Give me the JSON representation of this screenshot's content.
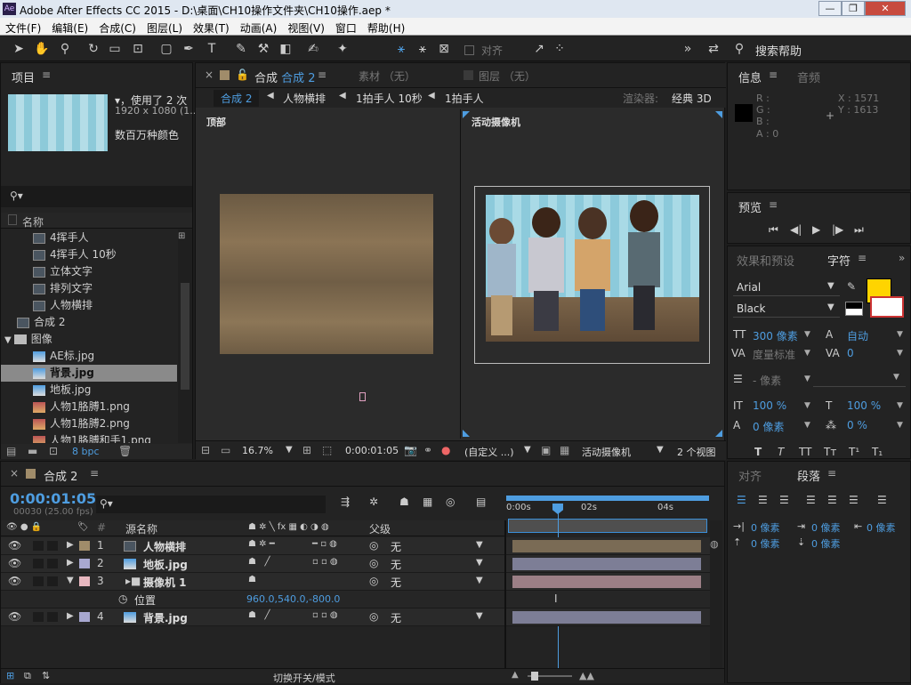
{
  "titlebar": {
    "title": "Adobe After Effects CC 2015 - D:\\桌面\\CH10操作文件夹\\CH10操作.aep *",
    "min": "—",
    "max": "❐",
    "close": "✕"
  },
  "menu": [
    "文件(F)",
    "编辑(E)",
    "合成(C)",
    "图层(L)",
    "效果(T)",
    "动画(A)",
    "视图(V)",
    "窗口",
    "帮助(H)"
  ],
  "toolbar": {
    "align": "对齐",
    "search": "搜索帮助"
  },
  "project": {
    "tab": "项目",
    "info_line1": "▾，使用了 2 次",
    "info_line2": "1920 x 1080 (1...",
    "info_line3": "数百万种颜色",
    "search_placeholder": "",
    "col_name": "名称",
    "items": [
      {
        "label": "4挥手人",
        "type": "comp"
      },
      {
        "label": "4挥手人 10秒",
        "type": "comp"
      },
      {
        "label": "立体文字",
        "type": "comp"
      },
      {
        "label": "排列文字",
        "type": "comp"
      },
      {
        "label": "人物横排",
        "type": "comp"
      },
      {
        "label": "合成 2",
        "type": "comp"
      },
      {
        "label": "图像",
        "type": "folder"
      },
      {
        "label": "AE标.jpg",
        "type": "img"
      },
      {
        "label": "背景.jpg",
        "type": "img"
      },
      {
        "label": "地板.jpg",
        "type": "img"
      },
      {
        "label": "人物1胳膊1.png",
        "type": "png"
      },
      {
        "label": "人物1胳膊2.png",
        "type": "png"
      },
      {
        "label": "人物1胳膊和手1.png",
        "type": "png"
      }
    ],
    "bpc": "8 bpc"
  },
  "comp": {
    "tab_active": "合成 2",
    "tab_footage": "素材 （无）",
    "tab_layer": "图层 （无）",
    "crumbs": [
      "合成 2",
      "人物横排",
      "1拍手人 10秒",
      "1拍手人"
    ],
    "renderer_label": "渲染器:",
    "renderer": "经典 3D",
    "view_left": "顶部",
    "view_right": "活动摄像机",
    "zoom": "16.7%",
    "time": "0:00:01:05",
    "res": "(自定义 ...)",
    "camera": "活动摄像机",
    "views": "2 个视图"
  },
  "info": {
    "tab": "信息",
    "tab2": "音频",
    "r": "R :",
    "g": "G :",
    "b": "B :",
    "a": "A : 0",
    "x": "X : 1571",
    "y": "Y : 1613"
  },
  "preview": {
    "tab": "预览"
  },
  "character": {
    "tab_effects": "效果和预设",
    "tab_char": "字符",
    "font": "Arial",
    "style": "Black",
    "size": "300 像素",
    "leading": "自动",
    "kerning": "度量标准",
    "tracking": "0",
    "stroke": "- 像素",
    "vscale": "100 %",
    "hscale": "100 %",
    "baseline": "0 像素",
    "tsume": "0 %",
    "fill_color": "#ffd400"
  },
  "paragraph": {
    "tab_align": "对齐",
    "tab_para": "段落",
    "indent_left": "0 像素",
    "indent_first": "0 像素",
    "indent_right": "0 像素",
    "space_before": "0 像素",
    "space_after": "0 像素"
  },
  "timeline": {
    "tab": "合成 2",
    "time": "0:00:01:05",
    "frames": "00030 (25.00 fps)",
    "col_name": "源名称",
    "col_parent": "父级",
    "ruler": [
      "0:00s",
      "02s",
      "04s"
    ],
    "layers": [
      {
        "num": "1",
        "name": "人物横排",
        "parent": "无",
        "color": "#a08c6a",
        "bar": "#7a6b55"
      },
      {
        "num": "2",
        "name": "地板.jpg",
        "parent": "无",
        "color": "#a8a8d0",
        "bar": "#7d7e96"
      },
      {
        "num": "3",
        "name": "摄像机 1",
        "parent": "无",
        "color": "#e8b8c0",
        "bar": "#9c7f86"
      },
      {
        "num": "4",
        "name": "背景.jpg",
        "parent": "无",
        "color": "#a8a8d0",
        "bar": "#7d7e96"
      }
    ],
    "prop_name": "位置",
    "prop_value": "960.0,540.0,-800.0",
    "footer": "切换开关/模式"
  }
}
